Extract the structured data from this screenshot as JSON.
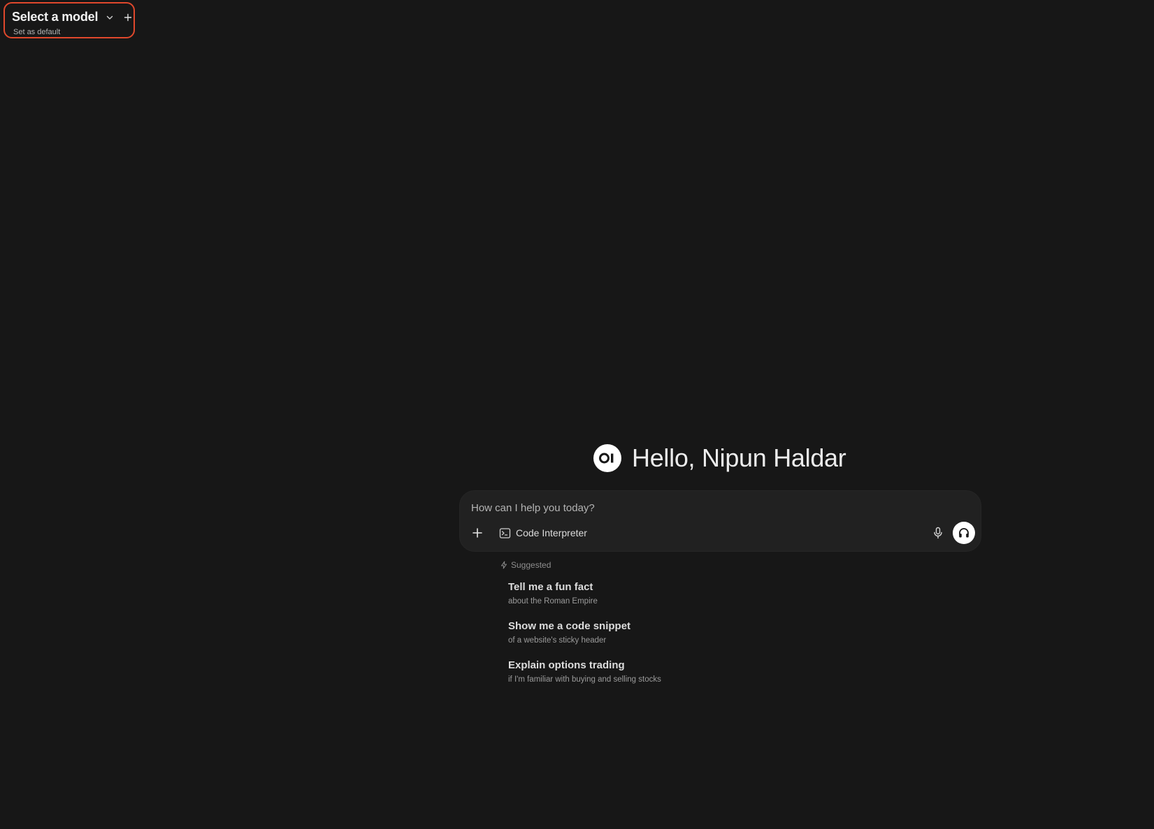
{
  "model_selector": {
    "title": "Select a model",
    "set_default_label": "Set as default",
    "highlight_color": "#e0482c",
    "chevron_icon": "chevron-down-icon",
    "add_icon": "plus-icon"
  },
  "greeting": {
    "logo_text": "OI",
    "text": "Hello, Nipun Haldar"
  },
  "chat": {
    "placeholder": "How can I help you today?",
    "value": "",
    "add_icon": "plus-icon",
    "tool_label": "Code Interpreter",
    "tool_icon": "terminal-icon",
    "mic_icon": "microphone-icon",
    "voice_icon": "headphones-icon"
  },
  "suggested": {
    "label": "Suggested",
    "icon": "bolt-icon",
    "items": [
      {
        "title": "Tell me a fun fact",
        "subtitle": "about the Roman Empire"
      },
      {
        "title": "Show me a code snippet",
        "subtitle": "of a website's sticky header"
      },
      {
        "title": "Explain options trading",
        "subtitle": "if I'm familiar with buying and selling stocks"
      }
    ]
  },
  "colors": {
    "background": "#171717",
    "input_background": "#212121",
    "accent_white": "#ffffff"
  }
}
